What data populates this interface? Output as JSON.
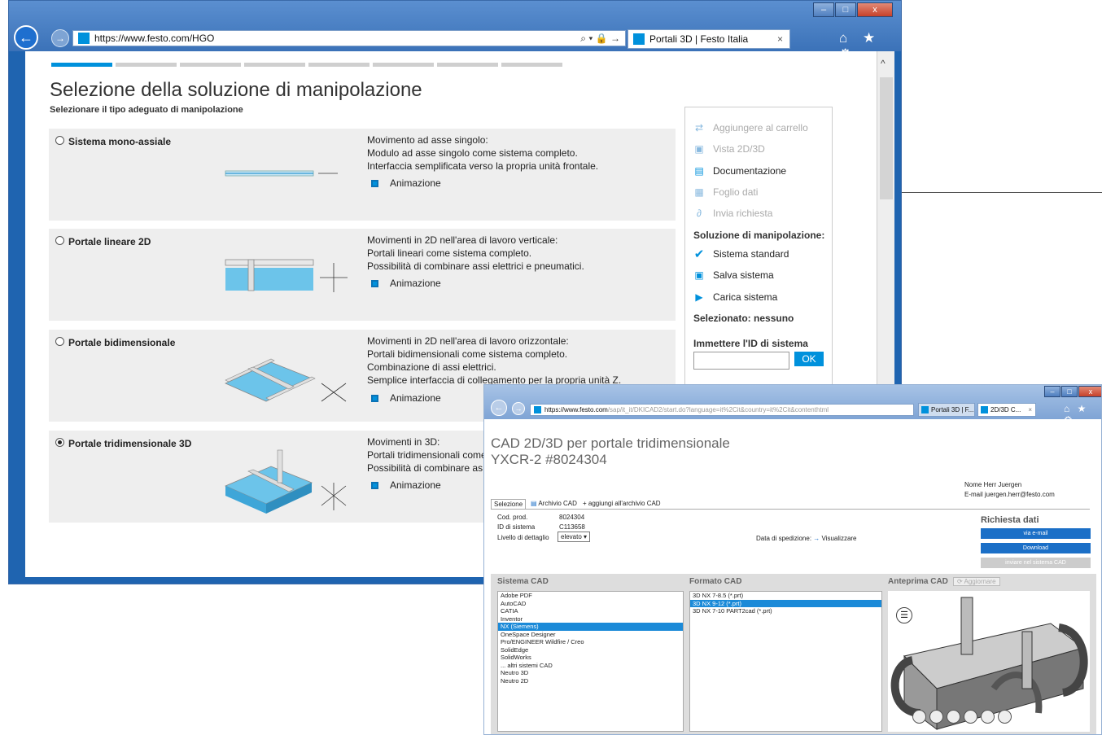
{
  "browser1": {
    "address": "https://www.festo.com/HGO",
    "tab_title": "Portali 3D | Festo Italia",
    "tab_close": "×",
    "min": "–",
    "max": "□",
    "close": "x",
    "address_icons": "⌕ ▾ 🔒 →",
    "toolbar_icons": "⌂ ★ ⚙"
  },
  "page": {
    "title": "Selezione della soluzione di manipolazione",
    "subtitle": "Selezionare il tipo adeguato di manipolazione",
    "animation_label": "Animazione",
    "options": [
      {
        "label": "Sistema mono-assiale",
        "selected": false,
        "desc": [
          "Movimento ad asse singolo:",
          "Modulo ad asse singolo come sistema completo.",
          "Interfaccia semplificata verso la propria unità frontale."
        ]
      },
      {
        "label": "Portale lineare 2D",
        "selected": false,
        "desc": [
          "Movimenti in 2D nell'area di lavoro verticale:",
          "Portali lineari come sistema completo.",
          "Possibilità di combinare assi elettrici e pneumatici."
        ]
      },
      {
        "label": "Portale bidimensionale",
        "selected": false,
        "desc": [
          "Movimenti in 2D nell'area di lavoro orizzontale:",
          "Portali bidimensionali come sistema completo.",
          "Combinazione di assi elettrici.",
          "Semplice interfaccia di collegamento per la propria unità Z."
        ]
      },
      {
        "label": "Portale tridimensionale 3D",
        "selected": true,
        "desc": [
          "Movimenti in 3D:",
          "Portali tridimensionali come",
          "Possibilità di combinare as"
        ]
      }
    ]
  },
  "sidebar": {
    "add_cart": "Aggiungere al carrello",
    "view": "Vista 2D/3D",
    "docs": "Documentazione",
    "datasheet": "Foglio dati",
    "request": "Invia richiesta",
    "solution_head": "Soluzione di manipolazione:",
    "standard": "Sistema standard",
    "save": "Salva sistema",
    "load": "Carica sistema",
    "selected": "Selezionato: nessuno",
    "id_head": "Immettere l'ID di sistema",
    "ok": "OK"
  },
  "browser2": {
    "address_host": "https://www.festo.com",
    "address_path": "/sap/it_it/DKICAD2/start.do?language=it%2Cit&country=it%2Cit&contenthtml",
    "tab1": "Portali 3D | F...",
    "tab2": "2D/3D C...",
    "title_line1": "CAD 2D/3D per portale tridimensionale",
    "title_line2": "YXCR-2 #8024304",
    "name_line": "Nome Herr Juergen",
    "email_line": "E-mail juergen.herr@festo.com",
    "tabs": [
      "Selezione",
      "Archivio CAD",
      "+ aggiungi all'archivio CAD"
    ],
    "cod_label": "Cod. prod.",
    "cod_value": "8024304",
    "id_label": "ID di sistema",
    "id_value": "C113658",
    "detail_label": "Livello di dettaglio",
    "detail_value": "elevato",
    "ship_label": "Data di spedizione:",
    "ship_link": "Visualizzare",
    "request_head": "Richiesta dati",
    "btn_email": "via e-mail",
    "btn_download": "Download",
    "btn_inverse": "inviare nel sistema CAD",
    "col_cad": "Sistema CAD",
    "col_format": "Formato CAD",
    "col_preview": "Anteprima CAD",
    "update": "Aggiornare",
    "cad_systems": [
      "Adobe PDF",
      "AutoCAD",
      "CATIA",
      "Inventor",
      "NX (Siemens)",
      "OneSpace Designer",
      "Pro/ENGINEER Wildfire / Creo",
      "SolidEdge",
      "SolidWorks",
      "... altri sistemi CAD",
      "Neutro 3D",
      "Neutro 2D"
    ],
    "cad_selected": "NX (Siemens)",
    "formats": [
      "3D NX 7-8.5 (*.prt)",
      "3D NX 9-12 (*.prt)",
      "3D NX 7-10 PART2cad (*.prt)"
    ],
    "format_selected": "3D NX 9-12 (*.prt)"
  }
}
